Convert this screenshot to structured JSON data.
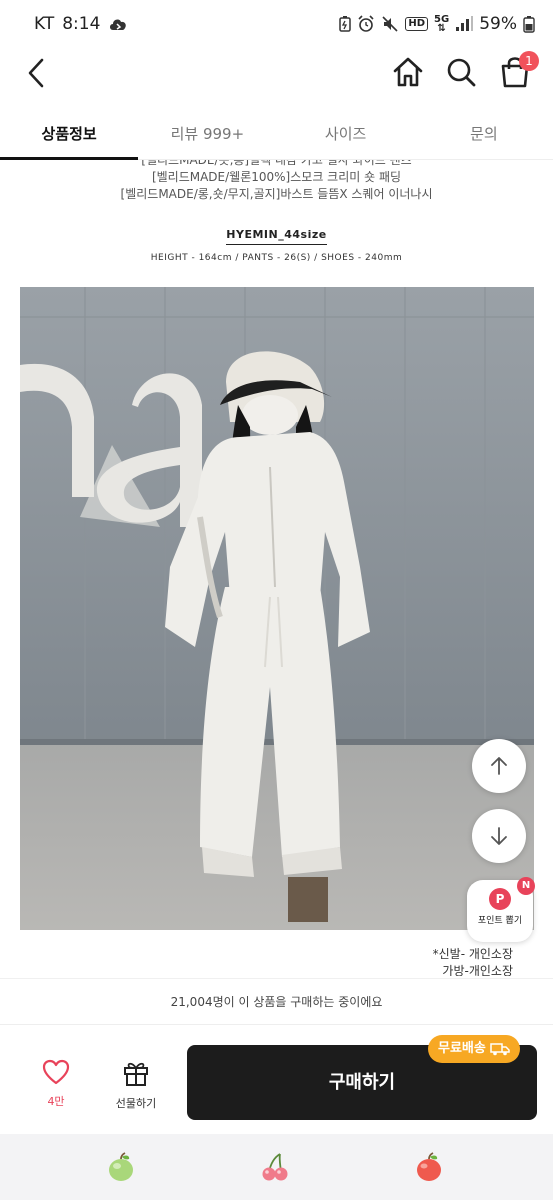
{
  "status_bar": {
    "carrier": "KT",
    "time": "8:14",
    "battery": "59%",
    "hd_label": "HD",
    "network_label": "5G"
  },
  "header": {
    "cart_count": "1"
  },
  "tabs": [
    {
      "label": "상품정보",
      "active": true
    },
    {
      "label": "리뷰 999+",
      "active": false
    },
    {
      "label": "사이즈",
      "active": false
    },
    {
      "label": "문의",
      "active": false
    }
  ],
  "content": {
    "promo_lines": [
      "[벨리드MADE/숏,롱]릴렉 내감 카고 필사 와이드 팬츠",
      "[벨리드MADE/웰론100%]스모크 크리미 숏 패딩",
      "[벨리드MADE/롱,숏/무지,골지]바스트 들뜸X 스퀘어 이너나시"
    ],
    "model_name": "HYEMIN_44size",
    "model_info": "HEIGHT - 164cm / PANTS - 26(S) / SHOES - 240mm",
    "caption_lines": [
      "*신발- 개인소장",
      "가방-개인소장"
    ]
  },
  "floating": {
    "point_label": "포인트 뽑기",
    "point_letter": "P",
    "point_badge": "N"
  },
  "purchase": {
    "buyers_text": "21,004명이 이 상품을 구매하는 중이에요",
    "like_count": "4만",
    "gift_label": "선물하기",
    "buy_label": "구매하기",
    "free_shipping_label": "무료배송"
  },
  "colors": {
    "accent_red": "#e8435a",
    "buy_button": "#1c1c1c",
    "free_shipping": "#f7a823"
  }
}
